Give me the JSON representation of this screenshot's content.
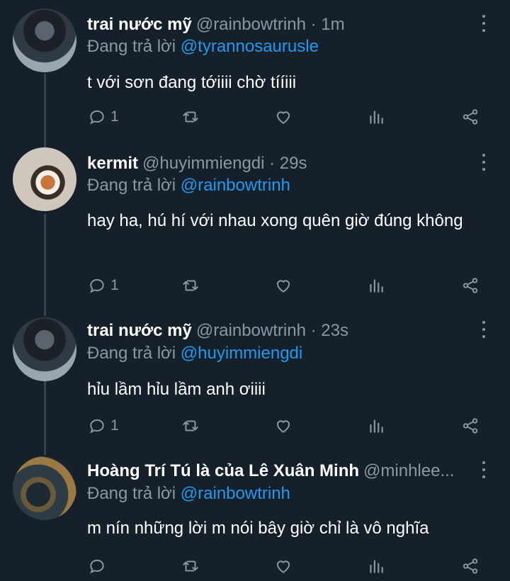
{
  "tweets": [
    {
      "name": "trai nước mỹ",
      "meta": "@rainbowtrinh · 1m",
      "reply_prefix": "Đang trả lời ",
      "reply_to": "@tyrannosaurusle",
      "text": "t với sơn đang tớiiii chờ tííiii",
      "reply_count": "1"
    },
    {
      "name": "kermit",
      "meta": "@huyimmiengdi · 29s",
      "reply_prefix": "Đang trả lời ",
      "reply_to": "@rainbowtrinh",
      "text": "hay ha, hú hí với nhau xong quên giờ đúng không",
      "reply_count": "1"
    },
    {
      "name": "trai nước mỹ",
      "meta": "@rainbowtrinh · 23s",
      "reply_prefix": "Đang trả lời ",
      "reply_to": "@huyimmiengdi",
      "text": "hỉu lầm hỉu lầm anh ơiiii",
      "reply_count": "1"
    },
    {
      "name": "Hoàng Trí Tú là của Lê Xuân Minh",
      "meta": "@minhlee...",
      "reply_prefix": "Đang trả lời ",
      "reply_to": "@rainbowtrinh",
      "text": "m nín những lời m nói bây giờ chỉ là vô nghĩa",
      "reply_count": ""
    }
  ],
  "icons": {
    "reply": "reply-icon",
    "retweet": "retweet-icon",
    "like": "heart-icon",
    "analytics": "analytics-icon",
    "share": "share-icon",
    "more": "more-vertical-icon"
  },
  "colors": {
    "background": "#15202b",
    "secondary_text": "#8899a6",
    "mention": "#1d9bf0",
    "thread_line": "#38444d"
  }
}
